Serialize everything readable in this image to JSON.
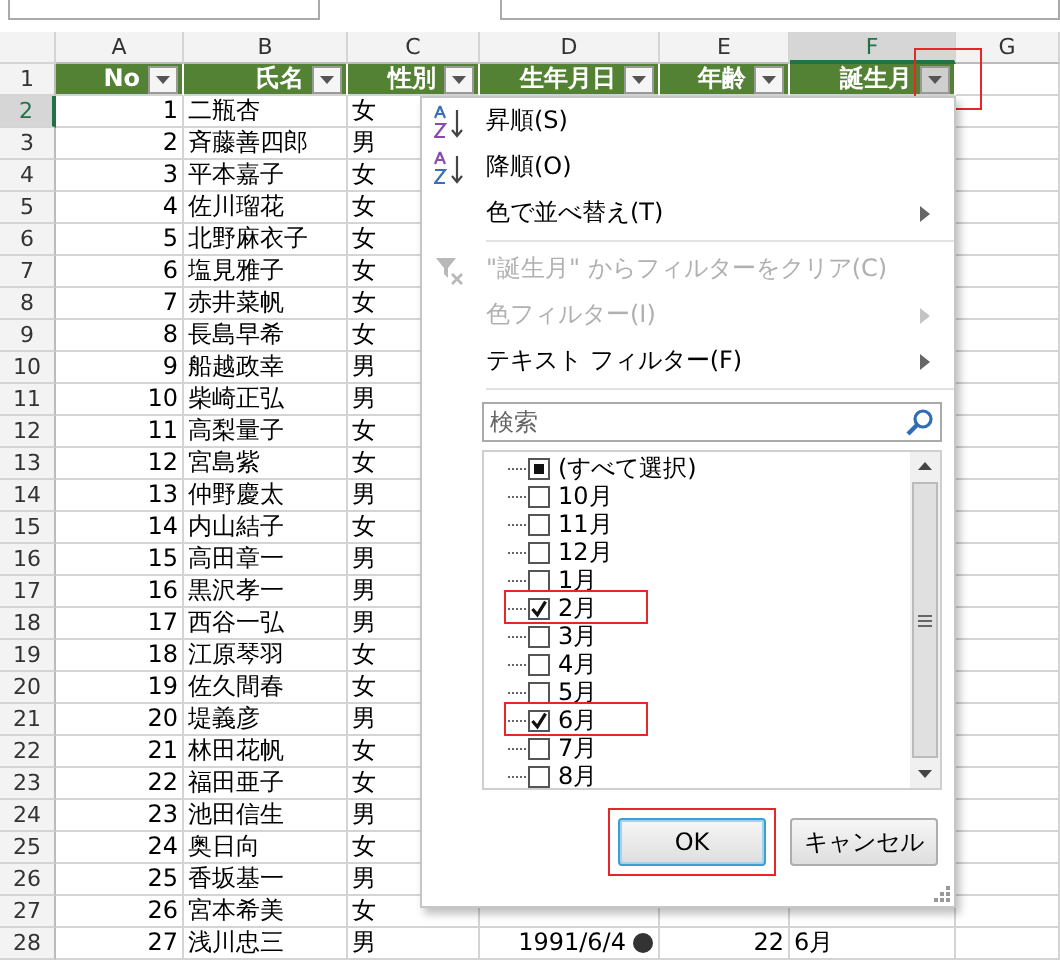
{
  "columns": [
    {
      "letter": "A",
      "selected": false
    },
    {
      "letter": "B",
      "selected": false
    },
    {
      "letter": "C",
      "selected": false
    },
    {
      "letter": "D",
      "selected": false
    },
    {
      "letter": "E",
      "selected": false
    },
    {
      "letter": "F",
      "selected": true
    },
    {
      "letter": "G",
      "selected": false
    }
  ],
  "header_row": "1",
  "headers": [
    {
      "label": "No",
      "pressed": false,
      "highlighted": false
    },
    {
      "label": "氏名",
      "pressed": false,
      "highlighted": false
    },
    {
      "label": "性別",
      "pressed": false,
      "highlighted": false
    },
    {
      "label": "生年月日",
      "pressed": false,
      "highlighted": false
    },
    {
      "label": "年齢",
      "pressed": false,
      "highlighted": false
    },
    {
      "label": "誕生月",
      "pressed": true,
      "highlighted": true
    }
  ],
  "rows": [
    {
      "row": "2",
      "no": "1",
      "name": "二瓶杏",
      "gender": "女",
      "selected": true
    },
    {
      "row": "3",
      "no": "2",
      "name": "斉藤善四郎",
      "gender": "男",
      "selected": false
    },
    {
      "row": "4",
      "no": "3",
      "name": "平本嘉子",
      "gender": "女",
      "selected": false
    },
    {
      "row": "5",
      "no": "4",
      "name": "佐川瑠花",
      "gender": "女",
      "selected": false
    },
    {
      "row": "6",
      "no": "5",
      "name": "北野麻衣子",
      "gender": "女",
      "selected": false
    },
    {
      "row": "7",
      "no": "6",
      "name": "塩見雅子",
      "gender": "女",
      "selected": false
    },
    {
      "row": "8",
      "no": "7",
      "name": "赤井菜帆",
      "gender": "女",
      "selected": false
    },
    {
      "row": "9",
      "no": "8",
      "name": "長島早希",
      "gender": "女",
      "selected": false
    },
    {
      "row": "10",
      "no": "9",
      "name": "船越政幸",
      "gender": "男",
      "selected": false
    },
    {
      "row": "11",
      "no": "10",
      "name": "柴崎正弘",
      "gender": "男",
      "selected": false
    },
    {
      "row": "12",
      "no": "11",
      "name": "高梨量子",
      "gender": "女",
      "selected": false
    },
    {
      "row": "13",
      "no": "12",
      "name": "宮島紫",
      "gender": "女",
      "selected": false
    },
    {
      "row": "14",
      "no": "13",
      "name": "仲野慶太",
      "gender": "男",
      "selected": false
    },
    {
      "row": "15",
      "no": "14",
      "name": "内山結子",
      "gender": "女",
      "selected": false
    },
    {
      "row": "16",
      "no": "15",
      "name": "高田章一",
      "gender": "男",
      "selected": false
    },
    {
      "row": "17",
      "no": "16",
      "name": "黒沢孝一",
      "gender": "男",
      "selected": false
    },
    {
      "row": "18",
      "no": "17",
      "name": "西谷一弘",
      "gender": "男",
      "selected": false
    },
    {
      "row": "19",
      "no": "18",
      "name": "江原琴羽",
      "gender": "女",
      "selected": false
    },
    {
      "row": "20",
      "no": "19",
      "name": "佐久間春",
      "gender": "女",
      "selected": false
    },
    {
      "row": "21",
      "no": "20",
      "name": "堤義彦",
      "gender": "男",
      "selected": false
    },
    {
      "row": "22",
      "no": "21",
      "name": "林田花帆",
      "gender": "女",
      "selected": false
    },
    {
      "row": "23",
      "no": "22",
      "name": "福田亜子",
      "gender": "女",
      "selected": false
    },
    {
      "row": "24",
      "no": "23",
      "name": "池田信生",
      "gender": "男",
      "selected": false
    },
    {
      "row": "25",
      "no": "24",
      "name": "奥日向",
      "gender": "女",
      "selected": false
    },
    {
      "row": "26",
      "no": "25",
      "name": "香坂基一",
      "gender": "男",
      "selected": false
    },
    {
      "row": "27",
      "no": "26",
      "name": "宮本希美",
      "gender": "女",
      "selected": false
    },
    {
      "row": "28",
      "no": "27",
      "name": "浅川忠三",
      "gender": "男",
      "birth": "1991/6/4",
      "age": "22",
      "month": "6月",
      "selected": false
    }
  ],
  "filter_menu": {
    "items": [
      {
        "kind": "sort-asc",
        "label": "昇順(S)",
        "disabled": false,
        "submenu": false
      },
      {
        "kind": "sort-desc",
        "label": "降順(O)",
        "disabled": false,
        "submenu": false
      },
      {
        "kind": "plain",
        "label": "色で並べ替え(T)",
        "disabled": false,
        "submenu": true
      },
      {
        "kind": "separator"
      },
      {
        "kind": "clear-filter",
        "label": "\"誕生月\" からフィルターをクリア(C)",
        "disabled": true,
        "submenu": false
      },
      {
        "kind": "plain",
        "label": "色フィルター(I)",
        "disabled": true,
        "submenu": true
      },
      {
        "kind": "plain",
        "label": "テキスト フィルター(F)",
        "disabled": false,
        "submenu": true
      },
      {
        "kind": "separator"
      }
    ],
    "search": {
      "placeholder": "検索"
    },
    "select_all": {
      "label": "(すべて選択)",
      "partial": true
    },
    "values": [
      {
        "label": "10月",
        "checked": false,
        "highlighted": false
      },
      {
        "label": "11月",
        "checked": false,
        "highlighted": false
      },
      {
        "label": "12月",
        "checked": false,
        "highlighted": false
      },
      {
        "label": "1月",
        "checked": false,
        "highlighted": false
      },
      {
        "label": "2月",
        "checked": true,
        "highlighted": true
      },
      {
        "label": "3月",
        "checked": false,
        "highlighted": false
      },
      {
        "label": "4月",
        "checked": false,
        "highlighted": false
      },
      {
        "label": "5月",
        "checked": false,
        "highlighted": false
      },
      {
        "label": "6月",
        "checked": true,
        "highlighted": true
      },
      {
        "label": "7月",
        "checked": false,
        "highlighted": false
      },
      {
        "label": "8月",
        "checked": false,
        "highlighted": false
      }
    ],
    "buttons": [
      {
        "label": "OK",
        "default": true,
        "highlighted": true
      },
      {
        "label": "キャンセル",
        "default": false,
        "highlighted": false
      }
    ]
  }
}
